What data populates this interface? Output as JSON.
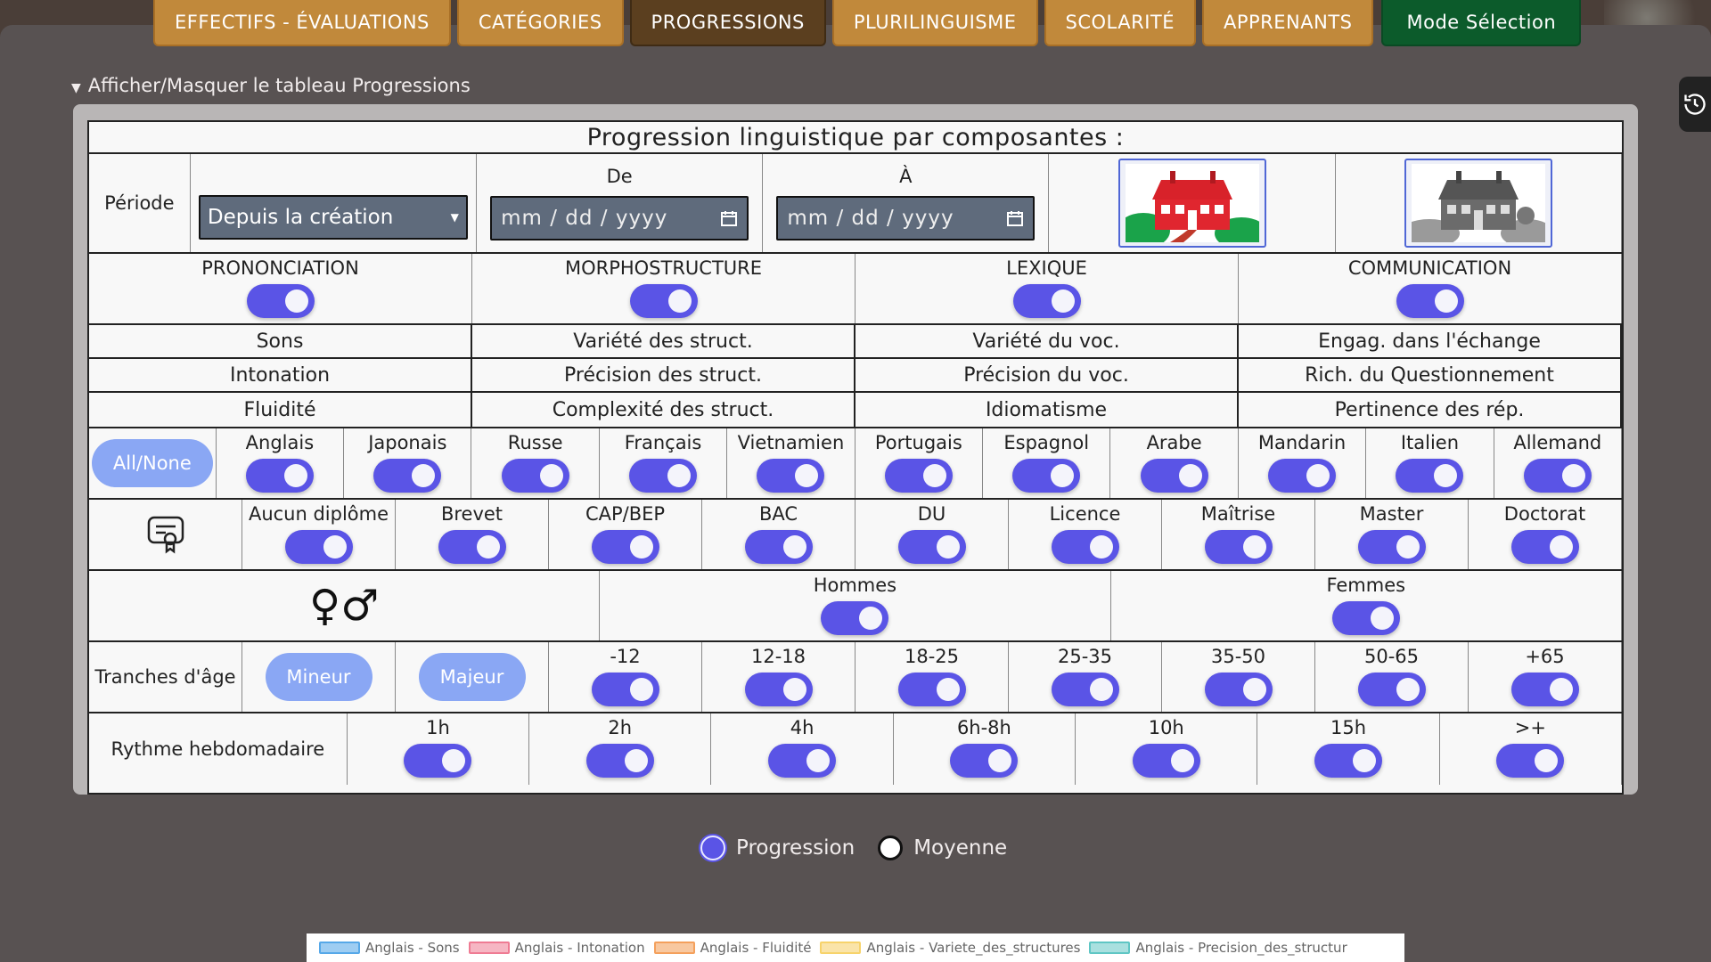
{
  "tabs": [
    {
      "label": "EFFECTIFS - ÉVALUATIONS",
      "active": false
    },
    {
      "label": "CATÉGORIES",
      "active": false
    },
    {
      "label": "PROGRESSIONS",
      "active": true
    },
    {
      "label": "PLURILINGUISME",
      "active": false
    },
    {
      "label": "SCOLARITÉ",
      "active": false
    },
    {
      "label": "APPRENANTS",
      "active": false
    }
  ],
  "mode_button": "Mode Sélection",
  "toggle_section": "Afficher/Masquer le tableau Progressions",
  "table": {
    "title": "Progression linguistique par composantes :",
    "period": {
      "label": "Période",
      "select_value": "Depuis la création",
      "from_label": "De",
      "to_label": "À",
      "from_placeholder": "mm / dd / yyyy",
      "to_placeholder": "mm / dd / yyyy"
    },
    "components": [
      "PRONONCIATION",
      "MORPHOSTRUCTURE",
      "LEXIQUE",
      "COMMUNICATION"
    ],
    "subcomponents": [
      [
        "Sons",
        "Variété des struct.",
        "Variété du voc.",
        "Engag. dans l'échange"
      ],
      [
        "Intonation",
        "Précision des struct.",
        "Précision du voc.",
        "Rich. du Questionnement"
      ],
      [
        "Fluidité",
        "Complexité des struct.",
        "Idiomatisme",
        "Pertinence des rép."
      ]
    ],
    "all_none": "All/None",
    "languages": [
      "Anglais",
      "Japonais",
      "Russe",
      "Français",
      "Vietnamien",
      "Portugais",
      "Espagnol",
      "Arabe",
      "Mandarin",
      "Italien",
      "Allemand"
    ],
    "diplomas": [
      "Aucun diplôme",
      "Brevet",
      "CAP/BEP",
      "BAC",
      "DU",
      "Licence",
      "Maîtrise",
      "Master",
      "Doctorat"
    ],
    "gender_symbol": "♀♂",
    "genders": [
      "Hommes",
      "Femmes"
    ],
    "age": {
      "label": "Tranches d'âge",
      "minor": "Mineur",
      "major": "Majeur",
      "ranges": [
        "-12",
        "12-18",
        "18-25",
        "25-35",
        "35-50",
        "50-65",
        "+65"
      ]
    },
    "rhythm": {
      "label": "Rythme hebdomadaire",
      "values": [
        "1h",
        "2h",
        "4h",
        "6h-8h",
        "10h",
        "15h",
        ">+"
      ]
    }
  },
  "radio": {
    "progression": "Progression",
    "moyenne": "Moyenne"
  },
  "legend": [
    {
      "label": "Anglais - Sons",
      "color": "#56a8e8"
    },
    {
      "label": "Anglais - Intonation",
      "color": "#ef7b93"
    },
    {
      "label": "Anglais - Fluidité",
      "color": "#f4a05c"
    },
    {
      "label": "Anglais - Variete_des_structures",
      "color": "#f7d36b"
    },
    {
      "label": "Anglais - Precision_des_structur",
      "color": "#5fc6c4"
    }
  ],
  "colors": {
    "tab": "#c1893b",
    "tab_active": "#5b3f1f",
    "mode": "#0c5b2b",
    "toggle": "#5a54e6",
    "pill": "#8aa7f4"
  }
}
